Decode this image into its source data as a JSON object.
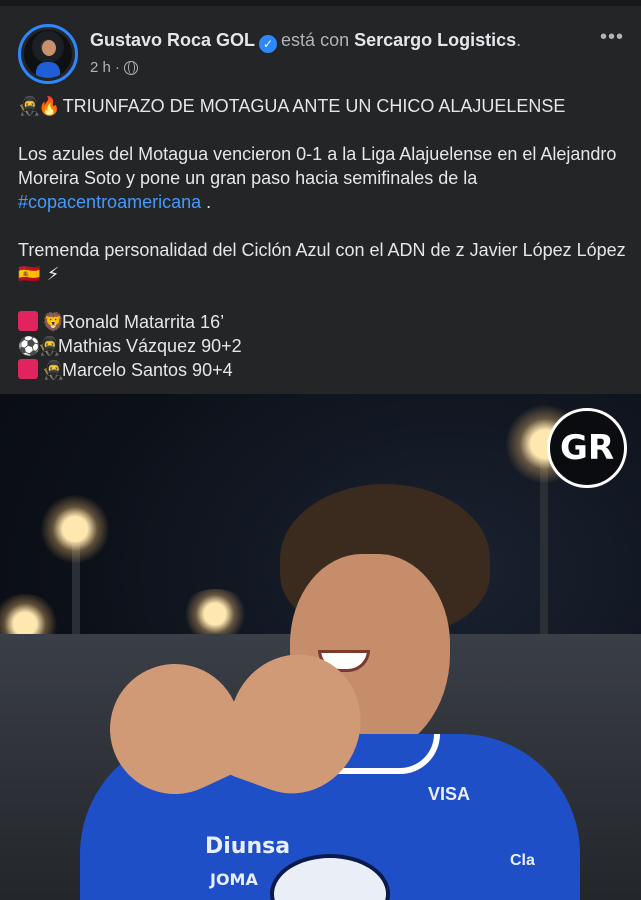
{
  "post": {
    "author": "Gustavo Roca GOL",
    "with_text": "está con",
    "tagged_page": "Sercargo Logistics",
    "timestamp": "2 h",
    "separator": "·",
    "more_label": "•••",
    "headline_emoji_1": "🥷",
    "headline_emoji_2": "🔥",
    "headline": "TRIUNFAZO DE MOTAGUA ANTE UN CHICO ALAJUELENSE",
    "paragraph_1": "Los azules del Motagua vencieron 0-1 a la Liga Alajuelense en el Alejandro Moreira Soto y pone un gran paso hacia semifinales de la",
    "hashtag": "#copacentroamericana",
    "paragraph_1_end": " .",
    "paragraph_2": "Tremenda personalidad del Ciclón Azul con el ADN de z Javier López López",
    "paragraph_2_emoji_1": "🇪🇸",
    "paragraph_2_emoji_2": "⚡",
    "events": [
      {
        "icon_1": "red-card",
        "icon_2": "🦁",
        "text": "Ronald Matarrita 16’"
      },
      {
        "icon_1": "⚽",
        "icon_2": "🥷",
        "text": "Mathias Vázquez 90+2"
      },
      {
        "icon_1": "red-card",
        "icon_2": "🥷",
        "text": "Marcelo Santos 90+4"
      }
    ]
  },
  "photo": {
    "logo_text": "GR",
    "sponsor_main": "Diunsa",
    "sponsor_secondary": "JOMA",
    "sponsor_chest": "VISA",
    "sponsor_sleeve": "Cla"
  },
  "colors": {
    "background": "#242526",
    "text": "#e4e6eb",
    "secondary_text": "#b0b3b8",
    "link": "#4599ff",
    "verified": "#2d88ff",
    "red_card": "#e0245e",
    "jersey": "#1f4fc7"
  }
}
